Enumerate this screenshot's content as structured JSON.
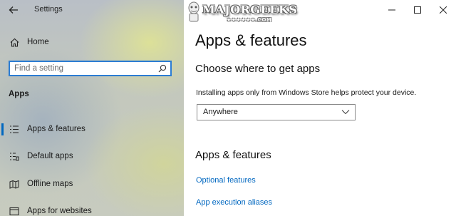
{
  "window": {
    "title": "Settings",
    "controls": [
      "minimize-icon",
      "maximize-icon",
      "close-icon"
    ]
  },
  "watermark": {
    "text": "MAJORGEEKS",
    "sub": "★★★★★★.COM"
  },
  "sidebar": {
    "home_label": "Home",
    "search": {
      "placeholder": "Find a setting",
      "value": ""
    },
    "section_heading": "Apps",
    "items": [
      {
        "label": "Apps & features",
        "icon": "list-icon",
        "selected": true
      },
      {
        "label": "Default apps",
        "icon": "default-apps-icon",
        "selected": false
      },
      {
        "label": "Offline maps",
        "icon": "map-icon",
        "selected": false
      },
      {
        "label": "Apps for websites",
        "icon": "web-link-icon",
        "selected": false
      }
    ]
  },
  "main": {
    "page_title": "Apps & features",
    "choose_heading": "Choose where to get apps",
    "install_description": "Installing apps only from Windows Store helps protect your device.",
    "install_source": {
      "selected": "Anywhere"
    },
    "apps_features_heading": "Apps & features",
    "links": [
      "Optional features",
      "App execution aliases"
    ]
  },
  "colors": {
    "accent": "#0067c0",
    "search_border": "#2b7cd3",
    "link": "#0067c0"
  }
}
